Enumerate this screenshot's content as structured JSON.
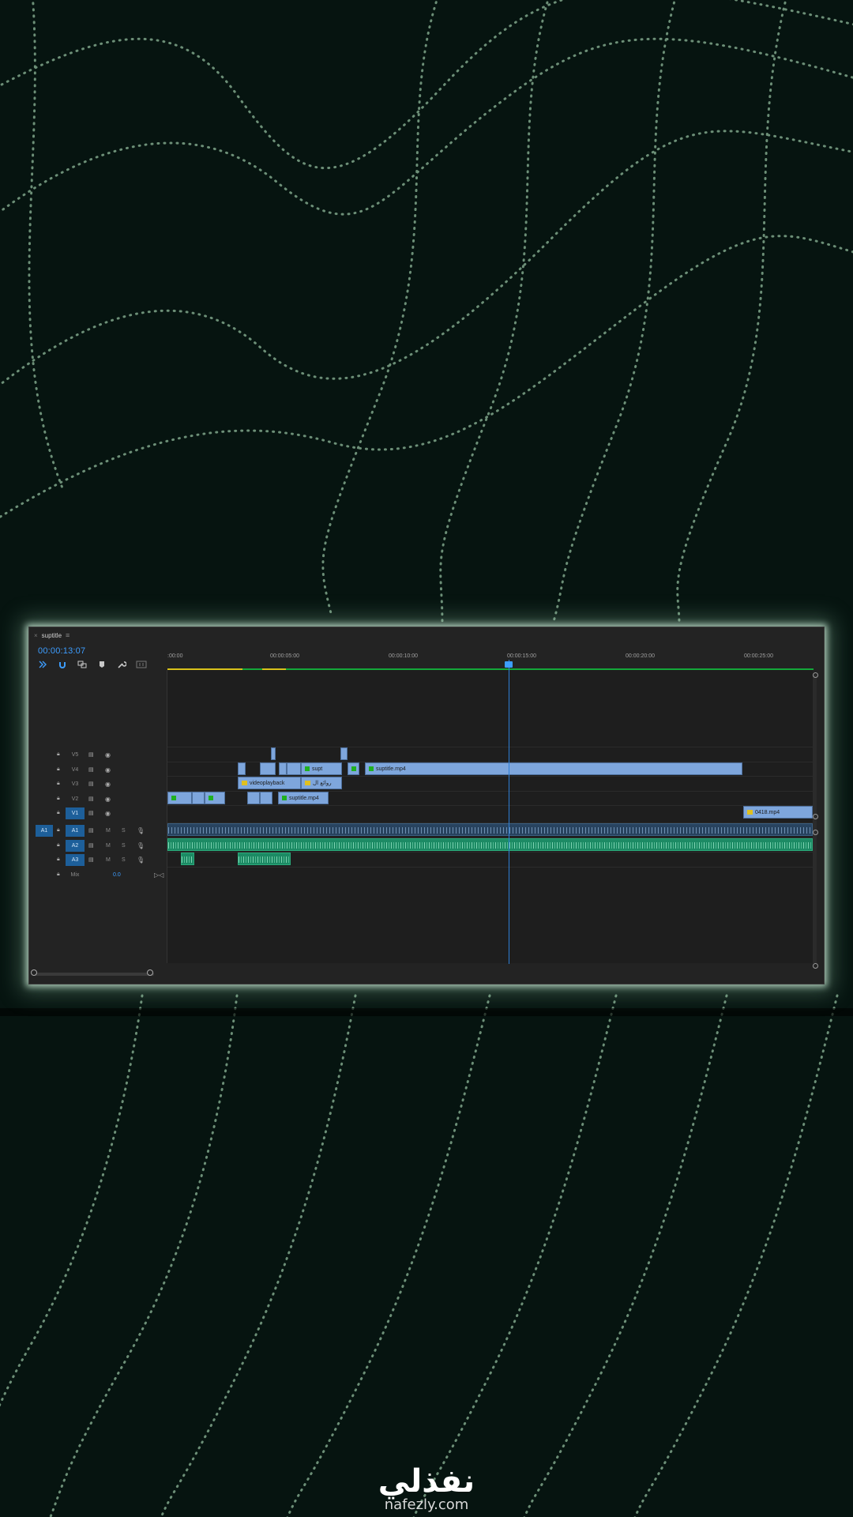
{
  "panel": {
    "tab_label": "suptitle",
    "close_glyph": "×",
    "menu_glyph": "≡",
    "timecode": "00:00:13:07"
  },
  "ruler": {
    "ticks": [
      ":00:00",
      "00:00:05:00",
      "00:00:10:00",
      "00:00:15:00",
      "00:00:20:00",
      "00:00:25:00"
    ]
  },
  "tracks": {
    "video": [
      {
        "name": "V5"
      },
      {
        "name": "V4"
      },
      {
        "name": "V3"
      },
      {
        "name": "V2"
      },
      {
        "name": "V1"
      }
    ],
    "audio": [
      {
        "name": "A1",
        "source": "A1",
        "m": "M",
        "s": "S"
      },
      {
        "name": "A2",
        "m": "M",
        "s": "S"
      },
      {
        "name": "A3",
        "m": "M",
        "s": "S"
      }
    ],
    "mix": {
      "label": "Mix",
      "value": "0.0"
    }
  },
  "clips": {
    "v4_a": "supt",
    "v4_b": "suptitle.mp4",
    "v3_a": "videoplayback",
    "v3_b": "روائع ال",
    "v2_a": "suptitle.mp4",
    "v1_a": "0418.mp4"
  },
  "icons": {
    "ripple": "ripple-edit-icon",
    "snap": "snap-magnet-icon",
    "linked": "linked-selection-icon",
    "marker": "add-marker-icon",
    "settings": "wrench-icon",
    "captions": "captions-icon",
    "lock": "lock-icon",
    "eye": "eye-icon",
    "mic": "microphone-icon"
  },
  "watermark": {
    "arabic": "نفذلي",
    "url": "nafezly.com"
  },
  "colors": {
    "accent_blue": "#3d9dff",
    "video_clip": "#7ea6dc",
    "audio_clip": "#1c8a64",
    "background": "#061410"
  }
}
